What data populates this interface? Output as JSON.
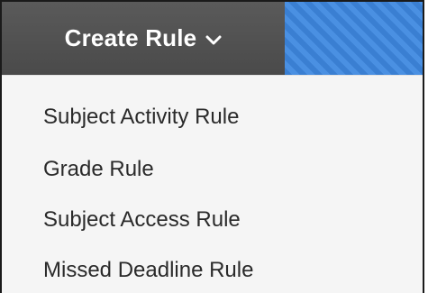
{
  "button": {
    "label": "Create Rule",
    "icon": "chevron-down-icon"
  },
  "menu": {
    "items": [
      {
        "label": "Subject Activity Rule"
      },
      {
        "label": "Grade Rule"
      },
      {
        "label": "Subject Access Rule"
      },
      {
        "label": "Missed Deadline Rule"
      }
    ]
  },
  "colors": {
    "button_bg": "#4a4a4a",
    "bar_accent": "#3b82d6",
    "menu_bg": "#f5f5f5",
    "menu_text": "#2a2a2a"
  }
}
